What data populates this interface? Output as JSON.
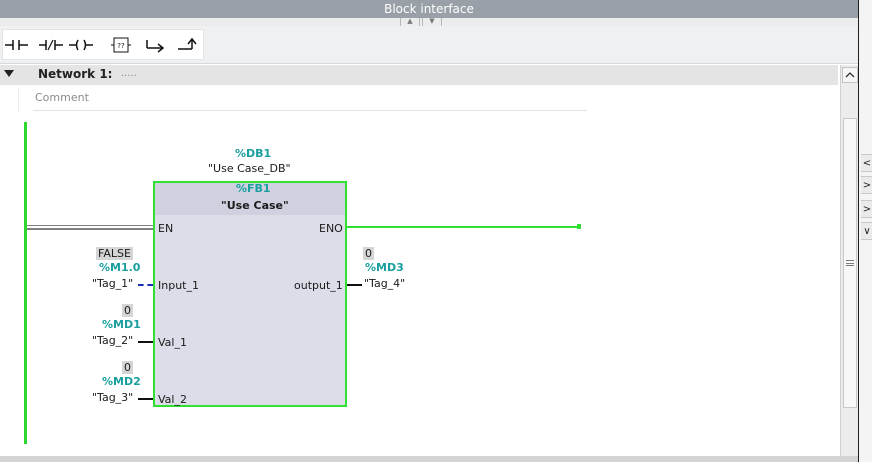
{
  "window": {
    "title": "Block interface"
  },
  "toolbar": {
    "buttons": [
      {
        "name": "no-contact-button",
        "icon": "normally-open-contact-icon"
      },
      {
        "name": "nc-contact-button",
        "icon": "normally-closed-contact-icon"
      },
      {
        "name": "coil-button",
        "icon": "coil-icon"
      },
      {
        "name": "empty-box-button",
        "icon": "empty-box-icon"
      },
      {
        "name": "open-branch-button",
        "icon": "open-branch-icon"
      },
      {
        "name": "close-branch-button",
        "icon": "close-branch-icon"
      }
    ],
    "empty_box_glyph": "??"
  },
  "network": {
    "title": "Network 1:",
    "title_dots": ".....",
    "comment_placeholder": "Comment"
  },
  "block": {
    "db_address": "%DB1",
    "db_name": "\"Use Case_DB\"",
    "fb_address": "%FB1",
    "fb_name": "\"Use Case\"",
    "pins": {
      "en": "EN",
      "eno": "ENO",
      "input_1": "Input_1",
      "val_1": "Val_1",
      "val_2": "Val_2",
      "output_1": "output_1"
    }
  },
  "operands": {
    "input_1": {
      "value": "FALSE",
      "address": "%M1.0",
      "tag": "\"Tag_1\""
    },
    "val_1": {
      "value": "0",
      "address": "%MD1",
      "tag": "\"Tag_2\""
    },
    "val_2": {
      "value": "0",
      "address": "%MD2",
      "tag": "\"Tag_3\""
    },
    "output_1": {
      "value": "0",
      "address": "%MD3",
      "tag": "\"Tag_4\""
    }
  },
  "sidebar": {
    "tabs": [
      "<",
      ">",
      ">",
      "∨"
    ]
  },
  "colors": {
    "power_rail": "#2fd62f",
    "active_wire": "#31e131",
    "address_text": "#1a9e9e",
    "block_fill": "#dcdde8"
  }
}
